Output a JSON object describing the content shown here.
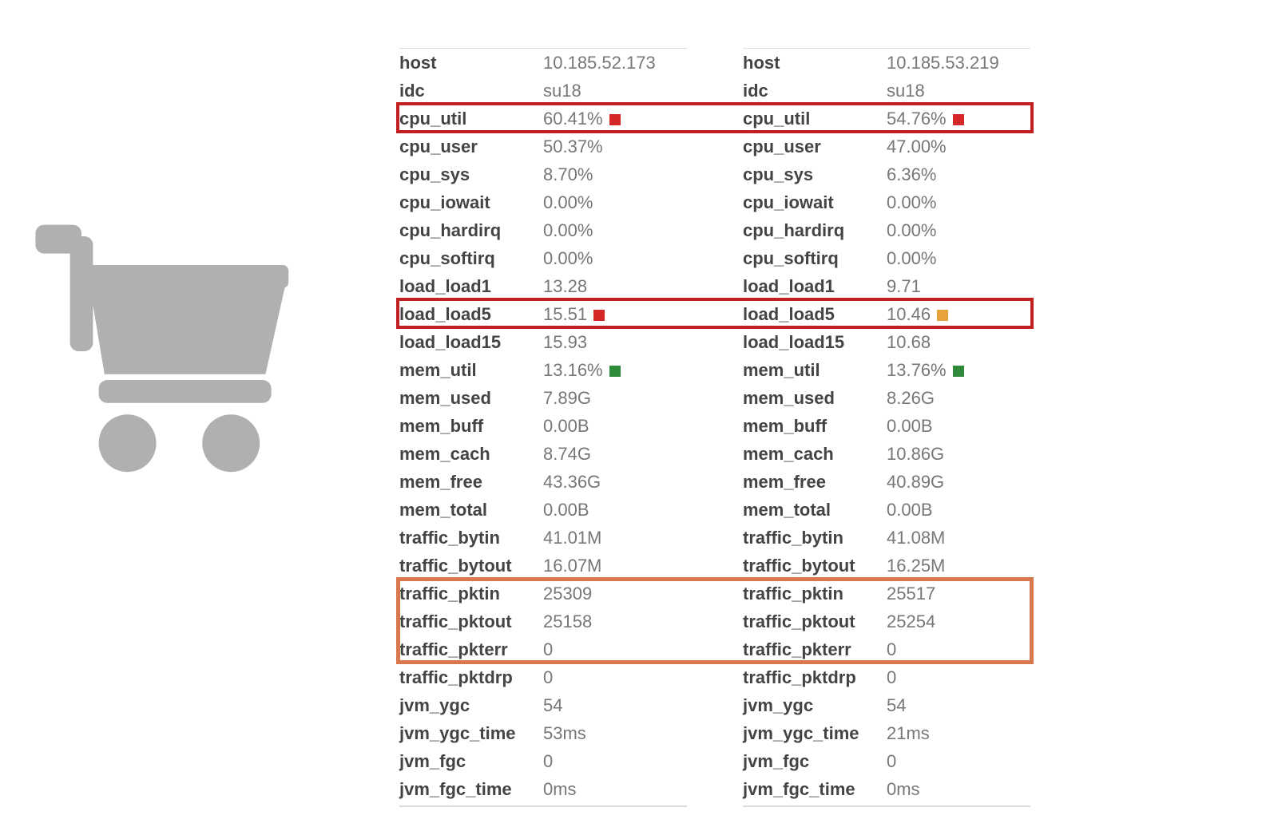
{
  "colors": {
    "swatch_red": "#d62728",
    "swatch_orange": "#e7a23b",
    "swatch_green": "#2e8b3a",
    "highlight_red": "#c22020",
    "highlight_orange": "#d8784f"
  },
  "icons": {
    "cart": "shopping-cart-icon"
  },
  "left": {
    "rows": [
      {
        "key": "host",
        "value": "10.185.52.173"
      },
      {
        "key": "idc",
        "value": "su18"
      },
      {
        "key": "cpu_util",
        "value": "60.41%",
        "swatch": "red"
      },
      {
        "key": "cpu_user",
        "value": "50.37%"
      },
      {
        "key": "cpu_sys",
        "value": "8.70%"
      },
      {
        "key": "cpu_iowait",
        "value": "0.00%"
      },
      {
        "key": "cpu_hardirq",
        "value": "0.00%"
      },
      {
        "key": "cpu_softirq",
        "value": "0.00%"
      },
      {
        "key": "load_load1",
        "value": "13.28"
      },
      {
        "key": "load_load5",
        "value": "15.51",
        "swatch": "red"
      },
      {
        "key": "load_load15",
        "value": "15.93"
      },
      {
        "key": "mem_util",
        "value": "13.16%",
        "swatch": "green"
      },
      {
        "key": "mem_used",
        "value": "7.89G"
      },
      {
        "key": "mem_buff",
        "value": "0.00B"
      },
      {
        "key": "mem_cach",
        "value": "8.74G"
      },
      {
        "key": "mem_free",
        "value": "43.36G"
      },
      {
        "key": "mem_total",
        "value": "0.00B"
      },
      {
        "key": "traffic_bytin",
        "value": "41.01M"
      },
      {
        "key": "traffic_bytout",
        "value": "16.07M"
      },
      {
        "key": "traffic_pktin",
        "value": "25309"
      },
      {
        "key": "traffic_pktout",
        "value": "25158"
      },
      {
        "key": "traffic_pkterr",
        "value": "0"
      },
      {
        "key": "traffic_pktdrp",
        "value": "0"
      },
      {
        "key": "jvm_ygc",
        "value": "54"
      },
      {
        "key": "jvm_ygc_time",
        "value": "53ms"
      },
      {
        "key": "jvm_fgc",
        "value": "0"
      },
      {
        "key": "jvm_fgc_time",
        "value": "0ms"
      }
    ]
  },
  "right": {
    "rows": [
      {
        "key": "host",
        "value": "10.185.53.219"
      },
      {
        "key": "idc",
        "value": "su18"
      },
      {
        "key": "cpu_util",
        "value": "54.76%",
        "swatch": "red"
      },
      {
        "key": "cpu_user",
        "value": "47.00%"
      },
      {
        "key": "cpu_sys",
        "value": "6.36%"
      },
      {
        "key": "cpu_iowait",
        "value": "0.00%"
      },
      {
        "key": "cpu_hardirq",
        "value": "0.00%"
      },
      {
        "key": "cpu_softirq",
        "value": "0.00%"
      },
      {
        "key": "load_load1",
        "value": "9.71"
      },
      {
        "key": "load_load5",
        "value": "10.46",
        "swatch": "orange"
      },
      {
        "key": "load_load15",
        "value": "10.68"
      },
      {
        "key": "mem_util",
        "value": "13.76%",
        "swatch": "green"
      },
      {
        "key": "mem_used",
        "value": "8.26G"
      },
      {
        "key": "mem_buff",
        "value": "0.00B"
      },
      {
        "key": "mem_cach",
        "value": "10.86G"
      },
      {
        "key": "mem_free",
        "value": "40.89G"
      },
      {
        "key": "mem_total",
        "value": "0.00B"
      },
      {
        "key": "traffic_bytin",
        "value": "41.08M"
      },
      {
        "key": "traffic_bytout",
        "value": "16.25M"
      },
      {
        "key": "traffic_pktin",
        "value": "25517"
      },
      {
        "key": "traffic_pktout",
        "value": "25254"
      },
      {
        "key": "traffic_pkterr",
        "value": "0"
      },
      {
        "key": "traffic_pktdrp",
        "value": "0"
      },
      {
        "key": "jvm_ygc",
        "value": "54"
      },
      {
        "key": "jvm_ygc_time",
        "value": "21ms"
      },
      {
        "key": "jvm_fgc",
        "value": "0"
      },
      {
        "key": "jvm_fgc_time",
        "value": "0ms"
      }
    ]
  },
  "highlights": [
    {
      "style": "red",
      "row_index": 2,
      "span_rows": 1
    },
    {
      "style": "red",
      "row_index": 9,
      "span_rows": 1
    },
    {
      "style": "orange",
      "row_index": 19,
      "span_rows": 3
    }
  ]
}
